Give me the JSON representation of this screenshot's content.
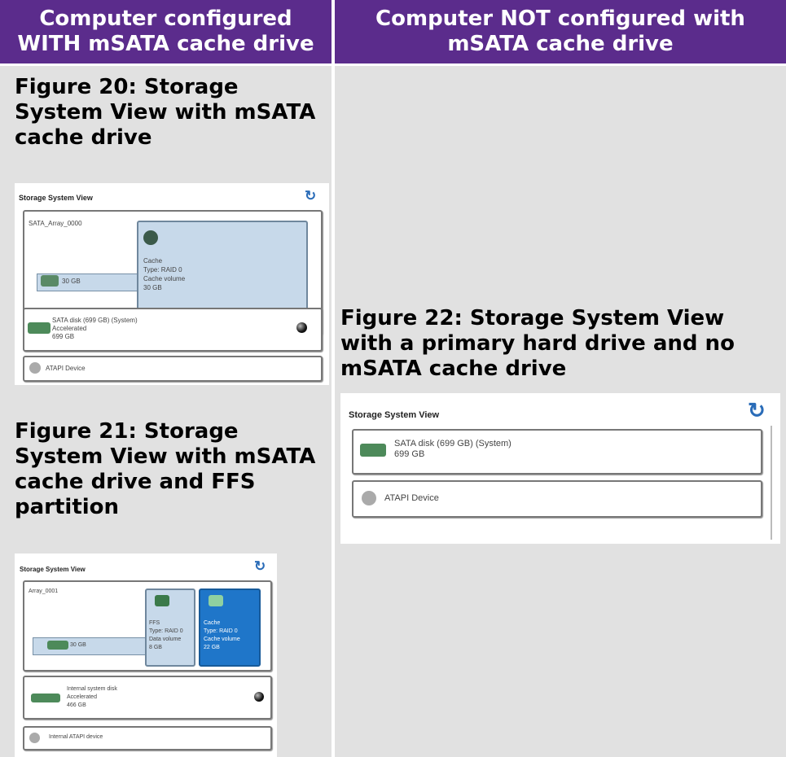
{
  "headers": {
    "left": [
      "Computer configured",
      "WITH mSATA cache drive"
    ],
    "right": [
      "Computer NOT configured with",
      "mSATA cache drive"
    ]
  },
  "captions": {
    "fig20": [
      "Figure 20: Storage",
      "System View with mSATA",
      "cache drive"
    ],
    "fig21": [
      "Figure 21: Storage",
      "System View with mSATA",
      "cache drive and FFS",
      "partition"
    ],
    "fig22": [
      "Figure 22: Storage System View",
      "with a primary hard drive and no",
      "mSATA cache drive"
    ]
  },
  "fig20": {
    "title": "Storage System View",
    "array": "SATA_Array_0000",
    "cache": [
      "Cache",
      "Type: RAID 0",
      "Cache volume",
      "30 GB"
    ],
    "bar": "30 GB",
    "disk": [
      "SATA disk (699 GB) (System)",
      "Accelerated",
      "699 GB"
    ],
    "atapi": "ATAPI Device"
  },
  "fig21": {
    "title": "Storage System View",
    "array": "Array_0001",
    "ffs": [
      "FFS",
      "Type: RAID 0",
      "Data volume",
      "8 GB"
    ],
    "cache": [
      "Cache",
      "Type: RAID 0",
      "Cache volume",
      "22 GB"
    ],
    "bar": "30 GB",
    "disk": [
      "Internal system disk",
      "Accelerated",
      "466 GB"
    ],
    "atapi": "Internal ATAPI device"
  },
  "fig22": {
    "title": "Storage System View",
    "disk": [
      "SATA disk (699 GB) (System)",
      "699 GB"
    ],
    "atapi": "ATAPI Device"
  },
  "icons": {
    "refresh": "refresh-icon",
    "disk": "hard-disk-icon",
    "optical": "optical-drive-icon",
    "status": "status-dot-icon"
  },
  "colors": {
    "header": "#5b2c8c",
    "cell": "#e1e1e1",
    "cache_selected": "#1f76c9",
    "cache_light": "#c7d9ea"
  }
}
